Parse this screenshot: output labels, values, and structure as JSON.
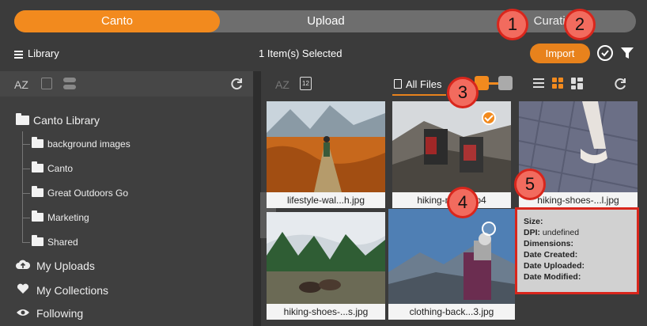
{
  "tabs": {
    "canto": "Canto",
    "upload": "Upload",
    "curation": "Curation"
  },
  "header": {
    "library_menu": "Library",
    "selected_count": "1 Item(s) Selected",
    "import_label": "Import"
  },
  "sidebar": {
    "sort_az": "AZ",
    "tree_root": "Canto Library",
    "folders": [
      "background images",
      "Canto",
      "Great Outdoors Go",
      "Marketing",
      "Shared"
    ],
    "links": {
      "my_uploads": "My Uploads",
      "my_collections": "My Collections",
      "following": "Following"
    }
  },
  "main": {
    "sort_az": "AZ",
    "calendar_day": "12",
    "all_files": "All Files",
    "accent_color": "#f28a1e"
  },
  "grid": {
    "items": [
      {
        "caption": "lifestyle-wal...h.jpg",
        "selected": false
      },
      {
        "caption": "hiking-mo…mp4",
        "selected": true
      },
      {
        "caption": "hiking-shoes-...l.jpg",
        "selected": false
      },
      {
        "caption": "hiking-shoes-...s.jpg",
        "selected": false
      },
      {
        "caption": "clothing-back...3.jpg",
        "selected": false
      }
    ]
  },
  "info_panel": {
    "size_label": "Size:",
    "dpi_label": "DPI:",
    "dpi_value": "undefined",
    "dimensions_label": "Dimensions:",
    "date_created_label": "Date Created:",
    "date_uploaded_label": "Date Uploaded:",
    "date_modified_label": "Date Modified:"
  },
  "callouts": [
    "1",
    "2",
    "3",
    "4",
    "5"
  ]
}
